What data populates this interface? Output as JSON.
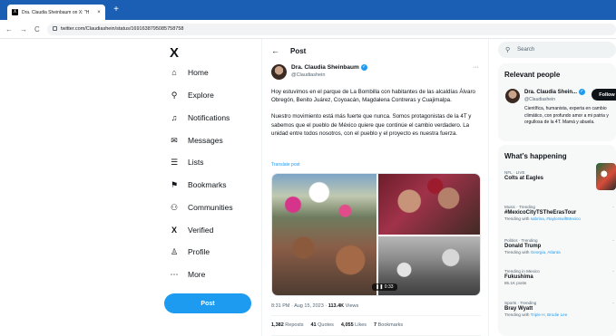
{
  "browser": {
    "tab_title": "Dra. Claudia Sheinbaum on X: \"H",
    "tab_close": "×",
    "new_tab": "+",
    "url": "twitter.com/Claudiashein/status/1691638795085758758",
    "back": "←",
    "forward": "→",
    "reload": "C"
  },
  "sidebar": {
    "logo": "X",
    "items": [
      {
        "label": "Home",
        "icon": "⌂"
      },
      {
        "label": "Explore",
        "icon": "⚲"
      },
      {
        "label": "Notifications",
        "icon": "♫"
      },
      {
        "label": "Messages",
        "icon": "✉"
      },
      {
        "label": "Lists",
        "icon": "☰"
      },
      {
        "label": "Bookmarks",
        "icon": "⚑"
      },
      {
        "label": "Communities",
        "icon": "⚇"
      },
      {
        "label": "Verified",
        "icon": "X"
      },
      {
        "label": "Profile",
        "icon": "♙"
      },
      {
        "label": "More",
        "icon": "⋯"
      }
    ],
    "post_button": "Post"
  },
  "post": {
    "header_title": "Post",
    "back_icon": "←",
    "author_name": "Dra. Claudia Sheinbaum",
    "author_handle": "@Claudiashein",
    "more": "···",
    "text_p1": "Hoy estuvimos en el parque de La Bombilla con habitantes de las alcaldías Álvaro Obregón, Benito Juárez, Coyoacán, Magdalena Contreras y Cuajimalpa.",
    "text_p2": "Nuestro movimiento está más fuerte que nunca. Somos protagonistas de la 4T y sabemos que el pueblo de México quiere que continúe el cambio verdadero. La unidad entre todos nosotros, con el pueblo y el proyecto es nuestra fuerza.",
    "translate": "Translate post",
    "video_duration": "0:33",
    "time": "8:31 PM · Aug 15, 2023 ·",
    "views_count": "113.4K",
    "views_label": "Views",
    "reposts_count": "1,382",
    "reposts_label": "Reposts",
    "quotes_count": "41",
    "quotes_label": "Quotes",
    "likes_count": "4,055",
    "likes_label": "Likes",
    "bookmarks_count": "7",
    "bookmarks_label": "Bookmarks"
  },
  "right": {
    "search_placeholder": "Search",
    "relevant_title": "Relevant people",
    "rp_name": "Dra. Claudia Shein...",
    "rp_handle": "@Claudiashein",
    "follow": "Follow",
    "rp_bio": "Científica, humanista, experta en cambio climático, con profundo amor a mi patria y orgullosa de la 4T. Mamá y abuela.",
    "happening_title": "What’s happening",
    "trends": [
      {
        "category": "NFL · LIVE",
        "title": "Colts at Eagles",
        "sub": "",
        "sub_link": ""
      },
      {
        "category": "Music · Trending",
        "title": "#MexicoCityTSTheErasTour",
        "sub": "Trending with ",
        "sub_link": "sabrina, #taylorswiftMexico"
      },
      {
        "category": "Politics · Trending",
        "title": "Donald Trump",
        "sub": "Trending with ",
        "sub_link": "Georgia, Atlanta"
      },
      {
        "category": "Trending in Mexico",
        "title": "Fukushima",
        "sub": "85.1K posts",
        "sub_link": ""
      },
      {
        "category": "Sports · Trending",
        "title": "Bray Wyatt",
        "sub": "Trending with ",
        "sub_link": "Triple H, Brodie Lee"
      }
    ]
  }
}
